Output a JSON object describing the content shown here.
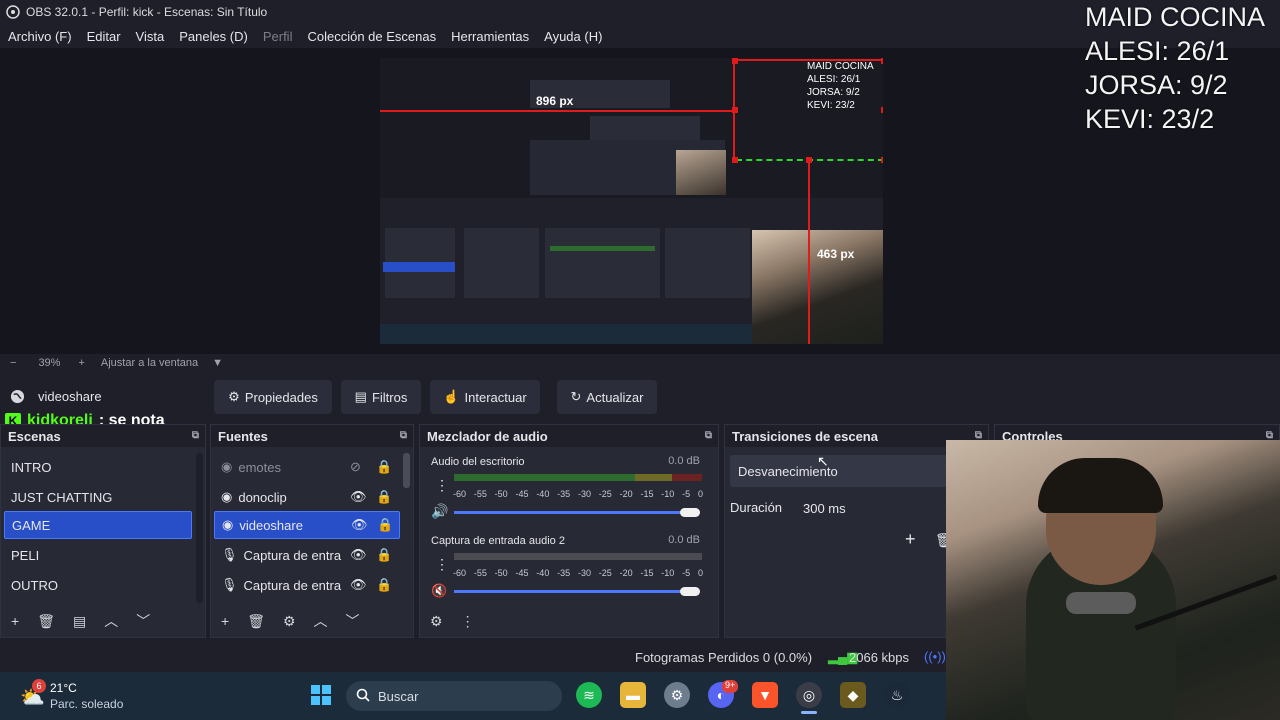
{
  "window": {
    "title": "OBS 32.0.1 - Perfil: kick - Escenas: Sin Título"
  },
  "menu": [
    "Archivo (F)",
    "Editar",
    "Vista",
    "Paneles (D)",
    "Perfil",
    "Colección de Escenas",
    "Herramientas",
    "Ayuda (H)"
  ],
  "overlay": {
    "line1": "MAID COCINA",
    "line2": "ALESI: 26/1",
    "line3": "JORSA: 9/2",
    "line4": "KEVI: 23/2"
  },
  "preview": {
    "width_label": "896 px",
    "height_label": "463 px",
    "mini_overlay": [
      "MAID COCINA",
      "ALESI: 26/1",
      "JORSA: 9/2",
      "KEVI: 23/2"
    ]
  },
  "zoom": {
    "minus": "−",
    "value": "39%",
    "plus": "+",
    "fit_label": "Ajustar a la ventana"
  },
  "source_toolbar": {
    "source_name": "videoshare",
    "properties": "Propiedades",
    "filters": "Filtros",
    "interact": "Interactuar",
    "refresh": "Actualizar"
  },
  "chat": {
    "user": "kidkoreli",
    "message": ": se nota"
  },
  "scenes": {
    "title": "Escenas",
    "items": [
      "INTRO",
      "JUST CHATTING",
      "GAME",
      "PELI",
      "OUTRO"
    ],
    "selected": "GAME"
  },
  "sources": {
    "title": "Fuentes",
    "items": [
      {
        "name": "emotes",
        "visible": false
      },
      {
        "name": "donoclip",
        "visible": true
      },
      {
        "name": "videoshare",
        "visible": true
      },
      {
        "name": "Captura de entra",
        "visible": true
      },
      {
        "name": "Captura de entra",
        "visible": true
      }
    ]
  },
  "mixer": {
    "title": "Mezclador de audio",
    "channels": [
      {
        "name": "Audio del escritorio",
        "db": "0.0 dB",
        "muted": false
      },
      {
        "name": "Captura de entrada audio 2",
        "db": "0.0 dB",
        "muted": true
      }
    ],
    "scale": [
      "-60",
      "-55",
      "-50",
      "-45",
      "-40",
      "-35",
      "-30",
      "-25",
      "-20",
      "-15",
      "-10",
      "-5",
      "0"
    ]
  },
  "transitions": {
    "title": "Transiciones de escena",
    "selected": "Desvanecimiento",
    "duration_label": "Duración",
    "duration_value": "300 ms"
  },
  "controls": {
    "title": "Controles"
  },
  "status": {
    "dropped": "Fotogramas Perdidos 0 (0.0%)",
    "bitrate": "2066 kbps"
  },
  "taskbar": {
    "weather_temp": "21°C",
    "weather_desc": "Parc. soleado",
    "weather_badge": "6",
    "search_placeholder": "Buscar",
    "discord_badge": "9+"
  }
}
